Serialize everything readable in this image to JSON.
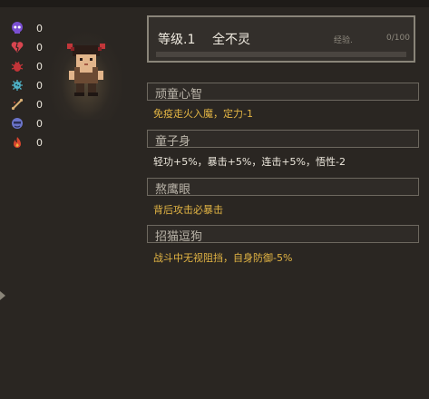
{
  "stats": [
    {
      "icon": "skull-icon",
      "value": "0",
      "color": "#7a4fd1"
    },
    {
      "icon": "broken-heart-icon",
      "value": "0",
      "color": "#d8454f"
    },
    {
      "icon": "bug-icon",
      "value": "0",
      "color": "#c23438"
    },
    {
      "icon": "germ-icon",
      "value": "0",
      "color": "#4fb3c8"
    },
    {
      "icon": "bone-icon",
      "value": "0",
      "color": "#d9b075"
    },
    {
      "icon": "mask-icon",
      "value": "0",
      "color": "#6b74c9"
    },
    {
      "icon": "flame-icon",
      "value": "0",
      "color": "#d8452f"
    }
  ],
  "character": {
    "level": "等级.1",
    "name": "全不灵",
    "exp_label": "经验.",
    "exp_value": "0/100",
    "exp_progress": 0
  },
  "traits": [
    {
      "title": "顽童心智",
      "desc": "免疫走火入魔，定力-1",
      "desc_color": "gold"
    },
    {
      "title": "童子身",
      "desc": "轻功+5%，暴击+5%，连击+5%，悟性-2",
      "desc_color": "white"
    },
    {
      "title": "熬鹰眼",
      "desc": "背后攻击必暴击",
      "desc_color": "gold"
    },
    {
      "title": "招猫逗狗",
      "desc": "战斗中无视阻挡，自身防御-5%",
      "desc_color": "gold"
    }
  ]
}
